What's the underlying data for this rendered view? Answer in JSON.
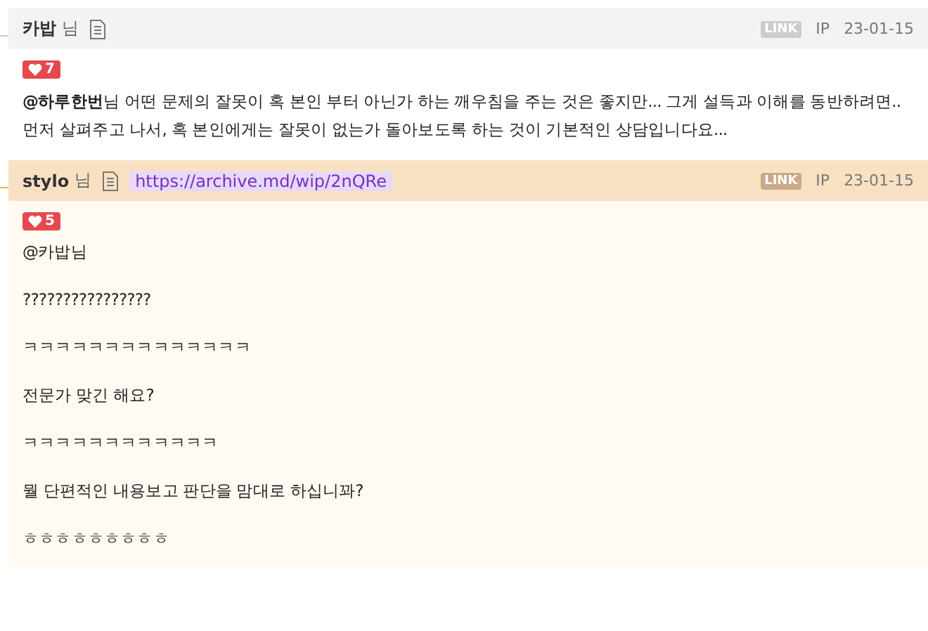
{
  "comments": [
    {
      "author": "카밥",
      "suffix": "님",
      "link_badge": "LINK",
      "ip": "IP",
      "date": "23-01-15",
      "likes": "7",
      "highlighted": false,
      "lines": [
        {
          "mention": "@하루한번",
          "text": "님 어떤 문제의 잘못이 혹 본인 부터 아닌가 하는 깨우침을 주는 것은 좋지만... 그게 설득과 이해를 동반하려면.."
        },
        {
          "text": "먼저 살펴주고 나서, 혹 본인에게는 잘못이 없는가 돌아보도록 하는 것이 기본적인 상담입니다요..."
        }
      ]
    },
    {
      "author": "stylo",
      "suffix": "님",
      "url": "https://archive.md/wip/2nQRe",
      "link_badge": "LINK",
      "ip": "IP",
      "date": "23-01-15",
      "likes": "5",
      "highlighted": true,
      "lines": [
        {
          "text": "@카밥님"
        },
        {
          "text": "????????????????"
        },
        {
          "text": "ㅋㅋㅋㅋㅋㅋㅋㅋㅋㅋㅋㅋㅋㅋ"
        },
        {
          "text": "전문가 맞긴 해요?"
        },
        {
          "text": "ㅋㅋㅋㅋㅋㅋㅋㅋㅋㅋㅋㅋ"
        },
        {
          "text": "뭘 단편적인 내용보고 판단을 맘대로 하십니꽈?"
        },
        {
          "text": "ㅎㅎㅎㅎㅎㅎㅎㅎㅎ"
        }
      ]
    }
  ]
}
